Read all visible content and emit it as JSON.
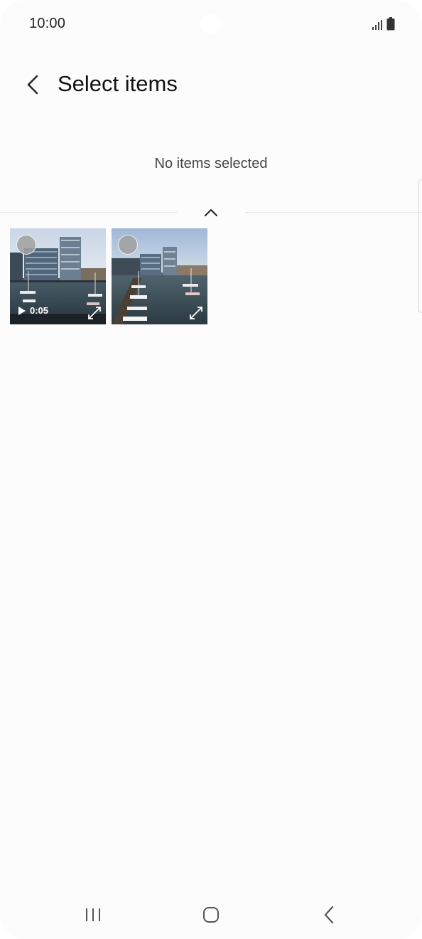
{
  "status_bar": {
    "time": "10:00",
    "signal_icon": "signal-icon",
    "battery_icon": "battery-icon"
  },
  "header": {
    "back_icon": "chevron-left-icon",
    "title": "Select items"
  },
  "selection": {
    "status_text": "No items selected",
    "collapse_icon": "chevron-up-icon"
  },
  "gallery": {
    "items": [
      {
        "type": "video",
        "duration": "0:05",
        "selected": false
      },
      {
        "type": "image",
        "selected": false
      }
    ]
  },
  "navigation_bar": {
    "recents_icon": "recents-icon",
    "home_icon": "home-icon",
    "back_icon": "back-icon"
  },
  "colors": {
    "background": "#fcfcfc",
    "text_primary": "#111111",
    "text_secondary": "#444444",
    "divider": "#e3e3e3"
  }
}
